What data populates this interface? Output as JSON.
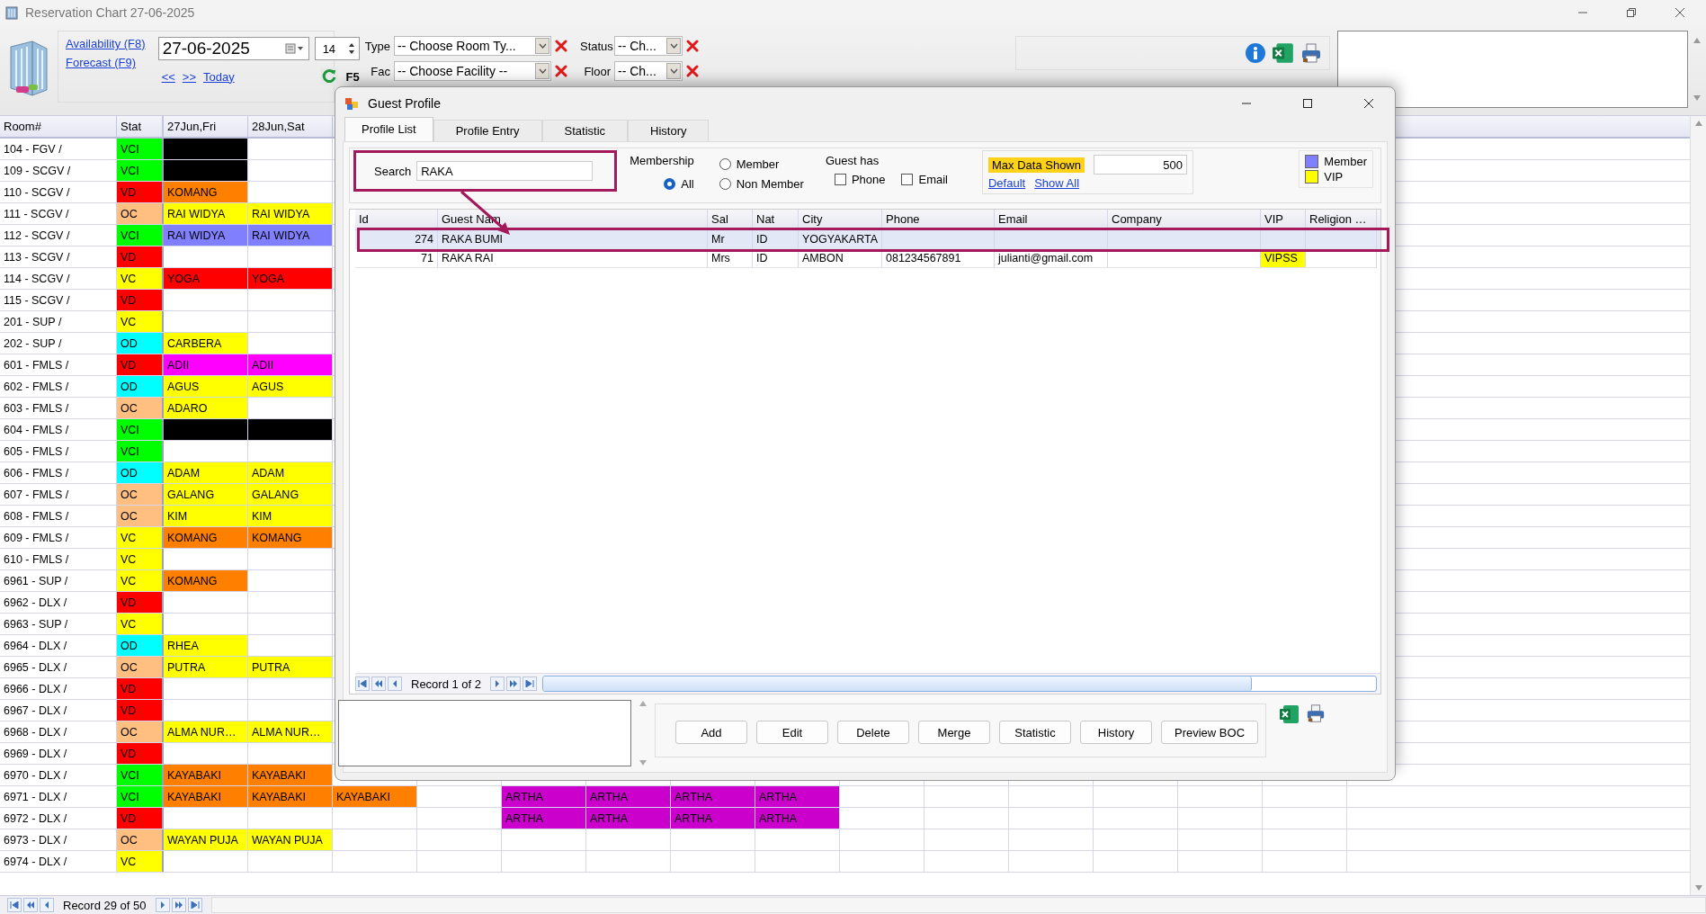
{
  "window": {
    "title": "Reservation Chart 27-06-2025"
  },
  "toolbar": {
    "links": [
      "Availability (F8)",
      "Forecast (F9)"
    ],
    "date": "27-06-2025",
    "days": "14",
    "nav": [
      "<<",
      ">>",
      "Today"
    ],
    "refresh_key": "F5",
    "filter_columns": [
      {
        "filters": [
          {
            "label": "Type",
            "value": "-- Choose Room Ty..."
          },
          {
            "label": "Fac",
            "value": "-- Choose Facility --"
          }
        ]
      },
      {
        "filters": [
          {
            "label": "Status",
            "value": "-- Ch..."
          },
          {
            "label": "Floor",
            "value": "-- Ch..."
          }
        ]
      }
    ]
  },
  "chart": {
    "room_header": "Room#",
    "stat_header": "Stat",
    "dates": [
      "27Jun,Fri",
      "28Jun,Sat"
    ],
    "rows": [
      {
        "room": "104 - FGV /",
        "stat": {
          "code": "VCI",
          "color": "#00ff00"
        },
        "cells": [
          {
            "color": "#000000"
          }
        ]
      },
      {
        "room": "109 - SCGV /",
        "stat": {
          "code": "VCI",
          "color": "#00ff00"
        },
        "cells": [
          {
            "color": "#000000"
          }
        ]
      },
      {
        "room": "110 - SCGV /",
        "stat": {
          "code": "VD",
          "color": "#ff0000"
        },
        "cells": [
          {
            "text": "KOMANG",
            "color": "#ff8000"
          }
        ]
      },
      {
        "room": "111 - SCGV /",
        "stat": {
          "code": "OC",
          "color": "#ffbf80"
        },
        "cells": [
          {
            "text": "RAI WIDYA",
            "color": "#ffff00"
          },
          {
            "text": "RAI WIDYA",
            "color": "#ffff00"
          }
        ]
      },
      {
        "room": "112 - SCGV /",
        "stat": {
          "code": "VCI",
          "color": "#00ff00"
        },
        "cells": [
          {
            "text": "RAI WIDYA",
            "color": "#8080ff"
          },
          {
            "text": "RAI WIDYA",
            "color": "#8080ff"
          }
        ]
      },
      {
        "room": "113 - SCGV /",
        "stat": {
          "code": "VD",
          "color": "#ff0000"
        },
        "cells": []
      },
      {
        "room": "114 - SCGV /",
        "stat": {
          "code": "VC",
          "color": "#ffff00"
        },
        "cells": [
          {
            "text": "YOGA",
            "color": "#ff0000"
          },
          {
            "text": "YOGA",
            "color": "#ff0000"
          }
        ]
      },
      {
        "room": "115 - SCGV /",
        "stat": {
          "code": "VD",
          "color": "#ff0000"
        },
        "cells": []
      },
      {
        "room": "201 - SUP /",
        "stat": {
          "code": "VC",
          "color": "#ffff00"
        },
        "cells": []
      },
      {
        "room": "202 - SUP /",
        "stat": {
          "code": "OD",
          "color": "#00ffff"
        },
        "cells": [
          {
            "text": "CARBERA",
            "color": "#ffff00"
          }
        ]
      },
      {
        "room": "601 - FMLS /",
        "stat": {
          "code": "VD",
          "color": "#ff0000"
        },
        "cells": [
          {
            "text": "ADII",
            "color": "#ff00ff"
          },
          {
            "text": "ADII",
            "color": "#ff00ff"
          }
        ]
      },
      {
        "room": "602 - FMLS /",
        "stat": {
          "code": "OD",
          "color": "#00ffff"
        },
        "cells": [
          {
            "text": "AGUS",
            "color": "#ffff00"
          },
          {
            "text": "AGUS",
            "color": "#ffff00"
          }
        ]
      },
      {
        "room": "603 - FMLS /",
        "stat": {
          "code": "OC",
          "color": "#ffbf80"
        },
        "cells": [
          {
            "text": "ADARO",
            "color": "#ffff00"
          }
        ]
      },
      {
        "room": "604 - FMLS /",
        "stat": {
          "code": "VCI",
          "color": "#00ff00"
        },
        "cells": [
          {
            "color": "#000000"
          },
          {
            "color": "#000000"
          }
        ]
      },
      {
        "room": "605 - FMLS /",
        "stat": {
          "code": "VCI",
          "color": "#00ff00"
        },
        "cells": []
      },
      {
        "room": "606 - FMLS /",
        "stat": {
          "code": "OD",
          "color": "#00ffff"
        },
        "cells": [
          {
            "text": "ADAM",
            "color": "#ffff00"
          },
          {
            "text": "ADAM",
            "color": "#ffff00"
          }
        ]
      },
      {
        "room": "607 - FMLS /",
        "stat": {
          "code": "OC",
          "color": "#ffbf80"
        },
        "cells": [
          {
            "text": "GALANG",
            "color": "#ffff00"
          },
          {
            "text": "GALANG",
            "color": "#ffff00"
          }
        ]
      },
      {
        "room": "608 - FMLS /",
        "stat": {
          "code": "OC",
          "color": "#ffbf80"
        },
        "cells": [
          {
            "text": "KIM",
            "color": "#ffff00"
          },
          {
            "text": "KIM",
            "color": "#ffff00"
          }
        ]
      },
      {
        "room": "609 - FMLS /",
        "stat": {
          "code": "VC",
          "color": "#ffff00"
        },
        "cells": [
          {
            "text": "KOMANG",
            "color": "#ff8000"
          },
          {
            "text": "KOMANG",
            "color": "#ff8000"
          }
        ]
      },
      {
        "room": "610 - FMLS /",
        "stat": {
          "code": "VC",
          "color": "#ffff00"
        },
        "cells": []
      },
      {
        "room": "6961 - SUP /",
        "stat": {
          "code": "VC",
          "color": "#ffff00"
        },
        "cells": [
          {
            "text": "KOMANG",
            "color": "#ff8000"
          }
        ]
      },
      {
        "room": "6962 - DLX /",
        "stat": {
          "code": "VD",
          "color": "#ff0000"
        },
        "cells": []
      },
      {
        "room": "6963 - SUP /",
        "stat": {
          "code": "VC",
          "color": "#ffff00"
        },
        "cells": []
      },
      {
        "room": "6964 - DLX /",
        "stat": {
          "code": "OD",
          "color": "#00ffff"
        },
        "cells": [
          {
            "text": "RHEA",
            "color": "#ffff00"
          }
        ]
      },
      {
        "room": "6965 - DLX /",
        "stat": {
          "code": "OC",
          "color": "#ffbf80"
        },
        "cells": [
          {
            "text": "PUTRA",
            "color": "#ffff00"
          },
          {
            "text": "PUTRA",
            "color": "#ffff00"
          }
        ]
      },
      {
        "room": "6966 - DLX /",
        "stat": {
          "code": "VD",
          "color": "#ff0000"
        },
        "cells": []
      },
      {
        "room": "6967 - DLX /",
        "stat": {
          "code": "VD",
          "color": "#ff0000"
        },
        "cells": []
      },
      {
        "room": "6968 - DLX /",
        "stat": {
          "code": "OC",
          "color": "#ffbf80"
        },
        "cells": [
          {
            "text": "ALMA NUR…",
            "color": "#ffff00"
          },
          {
            "text": "ALMA NUR…",
            "color": "#ffff00"
          }
        ]
      },
      {
        "room": "6969 - DLX /",
        "stat": {
          "code": "VD",
          "color": "#ff0000"
        },
        "cells": []
      },
      {
        "room": "6970 - DLX /",
        "stat": {
          "code": "VCI",
          "color": "#00ff00"
        },
        "cells": [
          {
            "text": "KAYABAKI",
            "color": "#ff8000"
          },
          {
            "text": "KAYABAKI",
            "color": "#ff8000"
          }
        ]
      },
      {
        "room": "6971 - DLX /",
        "stat": {
          "code": "VCI",
          "color": "#00ff00"
        },
        "cells": [
          {
            "text": "KAYABAKI",
            "color": "#ff8000"
          },
          {
            "text": "KAYABAKI",
            "color": "#ff8000"
          },
          {
            "text": "KAYABAKI",
            "color": "#ff8000"
          },
          null,
          {
            "text": "ARTHA",
            "color": "#cc00cc"
          },
          {
            "text": "ARTHA",
            "color": "#cc00cc"
          },
          {
            "text": "ARTHA",
            "color": "#cc00cc"
          },
          {
            "text": "ARTHA",
            "color": "#cc00cc"
          }
        ]
      },
      {
        "room": "6972 - DLX /",
        "stat": {
          "code": "VD",
          "color": "#ff0000"
        },
        "cells": [
          null,
          null,
          null,
          null,
          {
            "text": "ARTHA",
            "color": "#cc00cc"
          },
          {
            "text": "ARTHA",
            "color": "#cc00cc"
          },
          {
            "text": "ARTHA",
            "color": "#cc00cc"
          },
          {
            "text": "ARTHA",
            "color": "#cc00cc"
          }
        ]
      },
      {
        "room": "6973 - DLX /",
        "stat": {
          "code": "OC",
          "color": "#ffbf80"
        },
        "cells": [
          {
            "text": "WAYAN PUJA",
            "color": "#ffff00"
          },
          {
            "text": "WAYAN PUJA",
            "color": "#ffff00"
          }
        ]
      },
      {
        "room": "6974 - DLX /",
        "stat": {
          "code": "VC",
          "color": "#ffff00"
        },
        "cells": []
      }
    ],
    "record": "Record 29 of 50"
  },
  "dialog": {
    "title": "Guest Profile",
    "tabs": [
      {
        "label": "Profile List",
        "selected": true
      },
      {
        "label": "Profile Entry",
        "selected": false
      },
      {
        "label": "Statistic",
        "selected": false
      },
      {
        "label": "History",
        "selected": false
      }
    ],
    "search": {
      "label": "Search",
      "value": "RAKA"
    },
    "membership": {
      "label": "Membership",
      "options": [
        {
          "label": "All",
          "selected": true
        },
        {
          "label": "Member",
          "selected": false
        },
        {
          "label": "Non Member",
          "selected": false
        }
      ]
    },
    "guest_has": {
      "label": "Guest has",
      "options": [
        {
          "label": "Phone",
          "checked": false
        },
        {
          "label": "Email",
          "checked": false
        }
      ]
    },
    "max_data": {
      "label": "Max Data Shown",
      "value": "500",
      "links": [
        "Default",
        "Show All"
      ]
    },
    "legend": [
      {
        "label": "Member",
        "color": "#8080ff"
      },
      {
        "label": "VIP",
        "color": "#ffff00"
      }
    ],
    "table": {
      "columns": [
        "Id",
        "Guest Nam",
        "Sal",
        "Nat",
        "City",
        "Phone",
        "Email",
        "Company",
        "VIP",
        "Religion …"
      ],
      "rows": [
        {
          "selected": true,
          "vip": false,
          "cells": [
            "274",
            "RAKA BUMI",
            "Mr",
            "ID",
            "YOGYAKARTA",
            null,
            null,
            null,
            null,
            null
          ]
        },
        {
          "selected": false,
          "vip": true,
          "cells": [
            "71",
            "RAKA RAI",
            "Mrs",
            "ID",
            "AMBON",
            "081234567891",
            "julianti@gmail.com",
            null,
            "VIPSS",
            null
          ]
        }
      ]
    },
    "record": "Record 1 of 2",
    "buttons": [
      "Add",
      "Edit",
      "Delete",
      "Merge",
      "Statistic",
      "History",
      "Preview BOC"
    ]
  }
}
